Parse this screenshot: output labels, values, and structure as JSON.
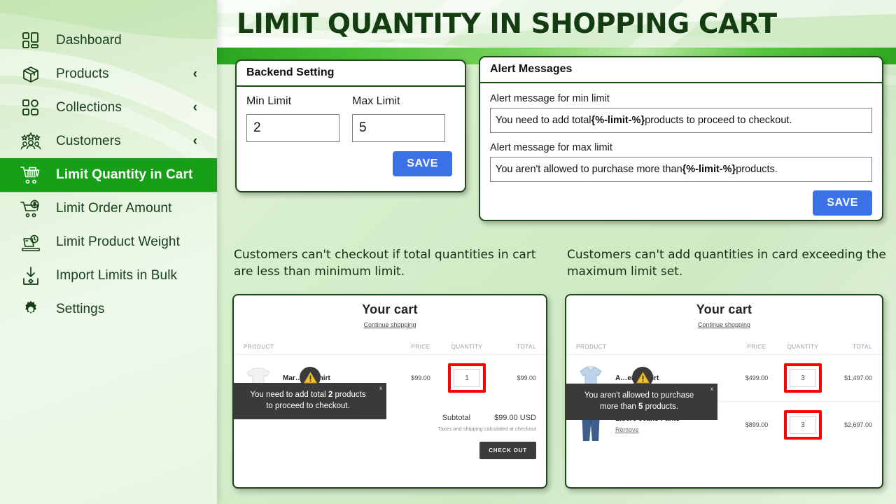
{
  "header": {
    "title": "LIMIT QUANTITY IN SHOPPING CART"
  },
  "sidebar": {
    "items": [
      {
        "label": "Dashboard",
        "icon": "dashboard-icon",
        "chevron": "",
        "active": false
      },
      {
        "label": "Products",
        "icon": "box-icon",
        "chevron": "‹",
        "active": false
      },
      {
        "label": "Collections",
        "icon": "grid-icon",
        "chevron": "‹",
        "active": false
      },
      {
        "label": "Customers",
        "icon": "customers-icon",
        "chevron": "‹",
        "active": false
      },
      {
        "label": "Limit Quantity in Cart",
        "icon": "cart-limit-icon",
        "chevron": "",
        "active": true
      },
      {
        "label": "Limit Order Amount",
        "icon": "cart-dollar-icon",
        "chevron": "",
        "active": false
      },
      {
        "label": "Limit Product Weight",
        "icon": "scale-icon",
        "chevron": "",
        "active": false
      },
      {
        "label": "Import Limits in Bulk",
        "icon": "import-icon",
        "chevron": "",
        "active": false
      },
      {
        "label": "Settings",
        "icon": "gear-icon",
        "chevron": "",
        "active": false
      }
    ]
  },
  "backend_setting": {
    "title": "Backend Setting",
    "min_limit_label": "Min Limit",
    "min_limit_value": "2",
    "max_limit_label": "Max Limit",
    "max_limit_value": "5",
    "save_label": "SAVE"
  },
  "alert_messages": {
    "title": "Alert Messages",
    "min_label": "Alert message for min limit",
    "min_value_pre": "You need to add total ",
    "min_value_token": "{%-limit-%}",
    "min_value_post": " products to proceed to checkout.",
    "max_label": "Alert message for max limit",
    "max_value_pre": "You aren't allowed to purchase more than ",
    "max_value_token": "{%-limit-%}",
    "max_value_post": " products.",
    "save_label": "SAVE"
  },
  "captions": {
    "left": "Customers can't checkout if total quantities in cart are less than minimum limit.",
    "right": "Customers can't add quantities in card exceeding the maximum limit set."
  },
  "cart_left": {
    "title": "Your cart",
    "continue_shopping": "Continue shopping",
    "columns": {
      "product": "PRODUCT",
      "price": "PRICE",
      "quantity": "QUANTITY",
      "total": "TOTAL"
    },
    "rows": [
      {
        "name": "Mar…e T-Shirt",
        "remove": "",
        "price": "$99.00",
        "qty": "1",
        "total": "$99.00",
        "thumb": "tshirt-thumb",
        "highlight": true
      }
    ],
    "subtotal_label": "Subtotal",
    "subtotal_value": "$99.00 USD",
    "tax_note": "Taxes and shipping calculated at checkout",
    "checkout_label": "CHECK OUT",
    "toast": {
      "pre": "You need to add total ",
      "bold": "2",
      "post": " products to proceed to checkout.",
      "close": "x",
      "icon": "warning-icon"
    }
  },
  "cart_right": {
    "title": "Your cart",
    "continue_shopping": "Continue shopping",
    "columns": {
      "product": "PRODUCT",
      "price": "PRICE",
      "quantity": "QUANTITY",
      "total": "TOTAL"
    },
    "rows": [
      {
        "name": "A…en's Shirt",
        "remove": "",
        "price": "$499.00",
        "qty": "3",
        "total": "$1,497.00",
        "thumb": "shirt-thumb",
        "highlight": true
      },
      {
        "name": "Libero Jeans Pants",
        "remove": "Remove",
        "price": "$899.00",
        "qty": "3",
        "total": "$2,697.00",
        "thumb": "jeans-thumb",
        "highlight": true
      }
    ],
    "toast": {
      "pre": "You aren't allowed to purchase more than ",
      "bold": "5",
      "post": " products.",
      "close": "x",
      "icon": "warning-icon"
    }
  },
  "colors": {
    "brand_green": "#17a017",
    "dark_green": "#133d11",
    "accent_blue": "#3b72e8",
    "highlight_red": "#ff0000",
    "toast_bg": "#3a3a3a",
    "warning_yellow": "#f2c230"
  }
}
